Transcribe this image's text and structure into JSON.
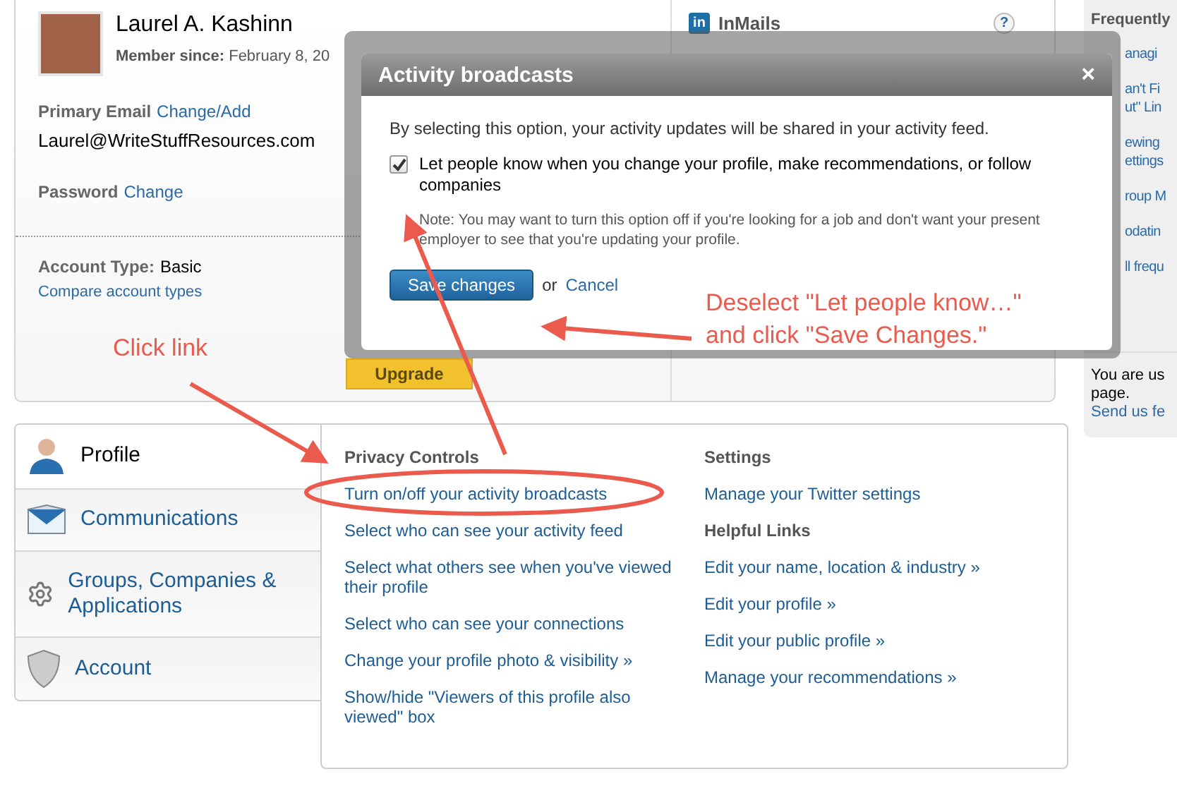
{
  "account": {
    "name": "Laurel A. Kashinn",
    "member_since_label": "Member since:",
    "member_since": "February 8, 20",
    "email_label": "Primary Email",
    "email_link": "Change/Add",
    "email": "Laurel@WriteStuffResources.com",
    "password_label": "Password",
    "password_link": "Change",
    "account_type_label": "Account Type:",
    "account_type": "Basic",
    "compare_link": "Compare account types",
    "upgrade": "Upgrade"
  },
  "inmails": {
    "logo": "in",
    "title": "InMails",
    "help": "?"
  },
  "frequently": {
    "title": "Frequently",
    "links": [
      {
        "lines": [
          "anagi"
        ]
      },
      {
        "lines": [
          "an't Fi",
          "ut\" Lin"
        ]
      },
      {
        "lines": [
          "ewing",
          "ettings"
        ]
      },
      {
        "lines": [
          "roup M"
        ]
      },
      {
        "lines": [
          "odatin"
        ]
      },
      {
        "lines": [
          "ll frequ"
        ]
      }
    ],
    "notice": [
      "You are us",
      "page."
    ],
    "feedback_link": "Send us fe"
  },
  "nav": [
    {
      "label": "Profile",
      "kind": "person",
      "selected": true
    },
    {
      "label": "Communications",
      "kind": "envelope",
      "selected": false
    },
    {
      "label": "Groups, Companies & Applications",
      "kind": "gear",
      "selected": false
    },
    {
      "label": "Account",
      "kind": "shield",
      "selected": false
    }
  ],
  "privacy": {
    "title": "Privacy Controls",
    "links": [
      "Turn on/off your activity broadcasts",
      "Select who can see your activity feed",
      "Select what others see when you've viewed their profile",
      "Select who can see your connections",
      "Change your profile photo & visibility »",
      "Show/hide \"Viewers of this profile also viewed\" box"
    ]
  },
  "settings": {
    "title": "Settings",
    "links": [
      "Manage your Twitter settings"
    ]
  },
  "helpful": {
    "title": "Helpful Links",
    "links": [
      "Edit your name, location & industry »",
      "Edit your profile »",
      "Edit your public profile »",
      "Manage your recommendations »"
    ]
  },
  "dialog": {
    "title": "Activity broadcasts",
    "close": "×",
    "intro": "By selecting this option, your activity updates will be shared in your activity feed.",
    "option": {
      "label": "Let people know when you change your profile, make recommendations, or follow companies",
      "checked": true
    },
    "note": "Note: You may want to turn this option off if you're looking for a job and don't want your present employer to see that you're updating your profile.",
    "save": "Save changes",
    "or": "or",
    "cancel": "Cancel"
  },
  "annotations": {
    "click_link": "Click link",
    "instruction": [
      "Deselect \"Let people know…\"",
      "and click \"Save Changes.\""
    ]
  }
}
